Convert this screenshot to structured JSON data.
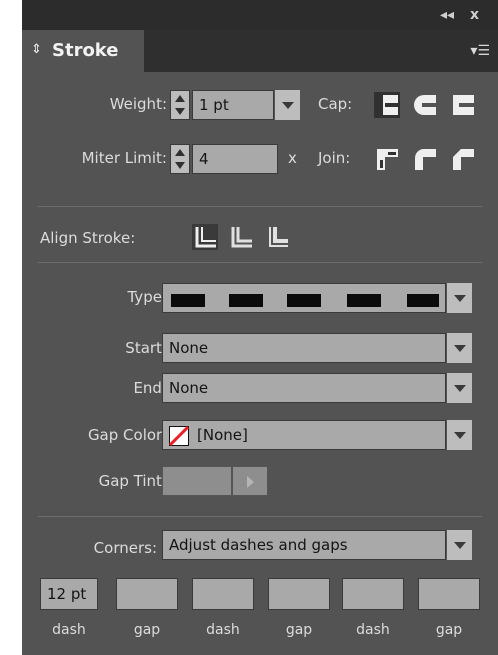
{
  "panel": {
    "title": "Stroke",
    "controls": {
      "collapse": "◂◂",
      "close": "x"
    },
    "icons": {
      "tab_arrows": "updown-arrows-icon",
      "menu": "panel-menu-icon"
    }
  },
  "weight": {
    "label": "Weight:",
    "value": "1 pt"
  },
  "cap": {
    "label": "Cap:",
    "options": [
      "butt-cap",
      "round-cap",
      "projecting-cap"
    ],
    "selected": 0
  },
  "miter": {
    "label": "Miter Limit:",
    "value": "4",
    "suffix": "x"
  },
  "join": {
    "label": "Join:",
    "options": [
      "miter-join",
      "round-join",
      "bevel-join"
    ],
    "selected": 0
  },
  "align": {
    "label": "Align Stroke:",
    "options": [
      "align-center",
      "align-inside",
      "align-outside"
    ],
    "selected": 0
  },
  "type": {
    "label": "Type:",
    "value": "dashed"
  },
  "start": {
    "label": "Start:",
    "value": "None"
  },
  "end": {
    "label": "End:",
    "value": "None"
  },
  "gap_color": {
    "label": "Gap Color:",
    "value": "[None]"
  },
  "gap_tint": {
    "label": "Gap Tint:",
    "value": ""
  },
  "corners": {
    "label": "Corners:",
    "value": "Adjust dashes and gaps"
  },
  "dash_gap": {
    "values": [
      "12 pt",
      "",
      "",
      "",
      "",
      ""
    ],
    "labels": [
      "dash",
      "gap",
      "dash",
      "gap",
      "dash",
      "gap"
    ]
  },
  "colors": {
    "panel_bg": "#535353",
    "header_bg": "#2c2c2c",
    "field_bg": "#a9a9a9",
    "label": "#dcdcdc",
    "swatch_red": "#e8202a"
  }
}
